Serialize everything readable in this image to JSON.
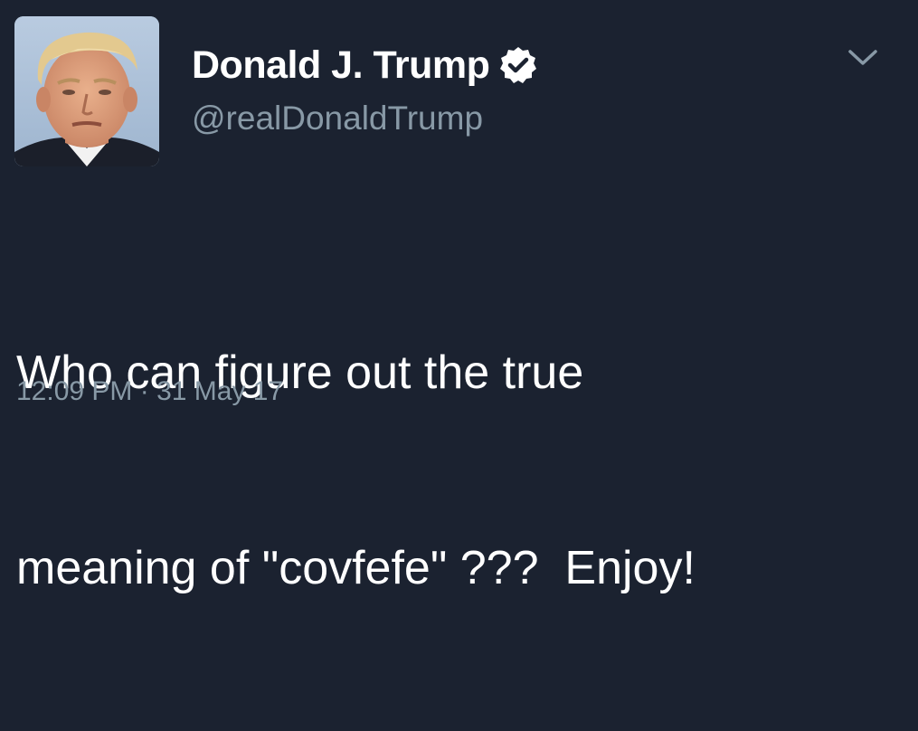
{
  "tweet": {
    "author": {
      "display_name": "Donald J. Trump",
      "handle": "@realDonaldTrump",
      "verified": true
    },
    "text_line_1": "Who can figure out the true",
    "text_line_2": "meaning of \"covfefe\" ???  Enjoy!",
    "timestamp": "12:09 PM · 31 May 17"
  },
  "icons": {
    "verified": "verified-badge-icon",
    "menu": "chevron-down-icon"
  },
  "colors": {
    "background": "#1b2230",
    "primary_text": "#ffffff",
    "secondary_text": "#8899a6"
  }
}
